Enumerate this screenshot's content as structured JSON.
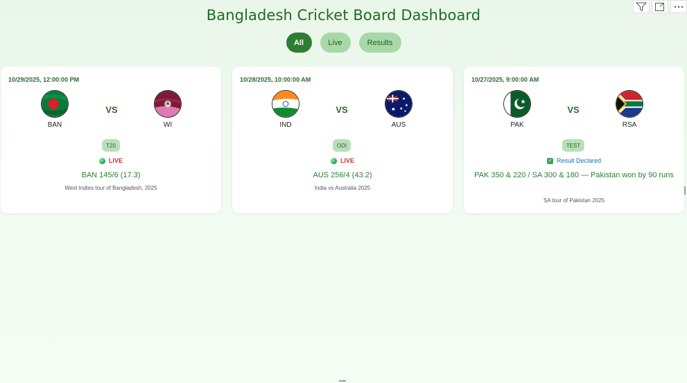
{
  "header": {
    "title": "Bangladesh Cricket Board Dashboard"
  },
  "toolbar": {
    "icons": [
      "filter-icon",
      "focus-mode-icon",
      "more-options-icon"
    ]
  },
  "filters": [
    {
      "label": "All",
      "active": true
    },
    {
      "label": "Live",
      "active": false
    },
    {
      "label": "Results",
      "active": false
    }
  ],
  "matches": [
    {
      "datetime": "10/29/2025, 12:00:00 PM",
      "team1": {
        "code": "BAN",
        "flag": "bangladesh-flag"
      },
      "vs": "VS",
      "team2": {
        "code": "WI",
        "flag": "west-indies-flag"
      },
      "format": "T20",
      "status": "LIVE",
      "score": "BAN 145/6 (17.3)",
      "series": "West Indies tour of Bangladesh, 2025"
    },
    {
      "datetime": "10/28/2025, 10:00:00 AM",
      "team1": {
        "code": "IND",
        "flag": "india-flag"
      },
      "vs": "VS",
      "team2": {
        "code": "AUS",
        "flag": "australia-flag"
      },
      "format": "ODI",
      "status": "LIVE",
      "score": "AUS 256/4 (43.2)",
      "series": "India vs Australia 2025"
    },
    {
      "datetime": "10/27/2025, 9:00:00 AM",
      "team1": {
        "code": "PAK",
        "flag": "pakistan-flag"
      },
      "vs": "VS",
      "team2": {
        "code": "RSA",
        "flag": "south-africa-flag"
      },
      "format": "TEST",
      "status": "Result Declared",
      "score": "PAK 350 & 220 / SA 300 & 180 — Pakistan won by 90 runs",
      "series": "SA tour of Pakistan 2025"
    }
  ],
  "colors": {
    "primary_green": "#2e7d32",
    "title_green": "#1e6b22",
    "live_red": "#d32f2f",
    "result_blue": "#1a6fb5",
    "pill_inactive": "#a8d8a8",
    "badge": "#b8e0b8"
  }
}
